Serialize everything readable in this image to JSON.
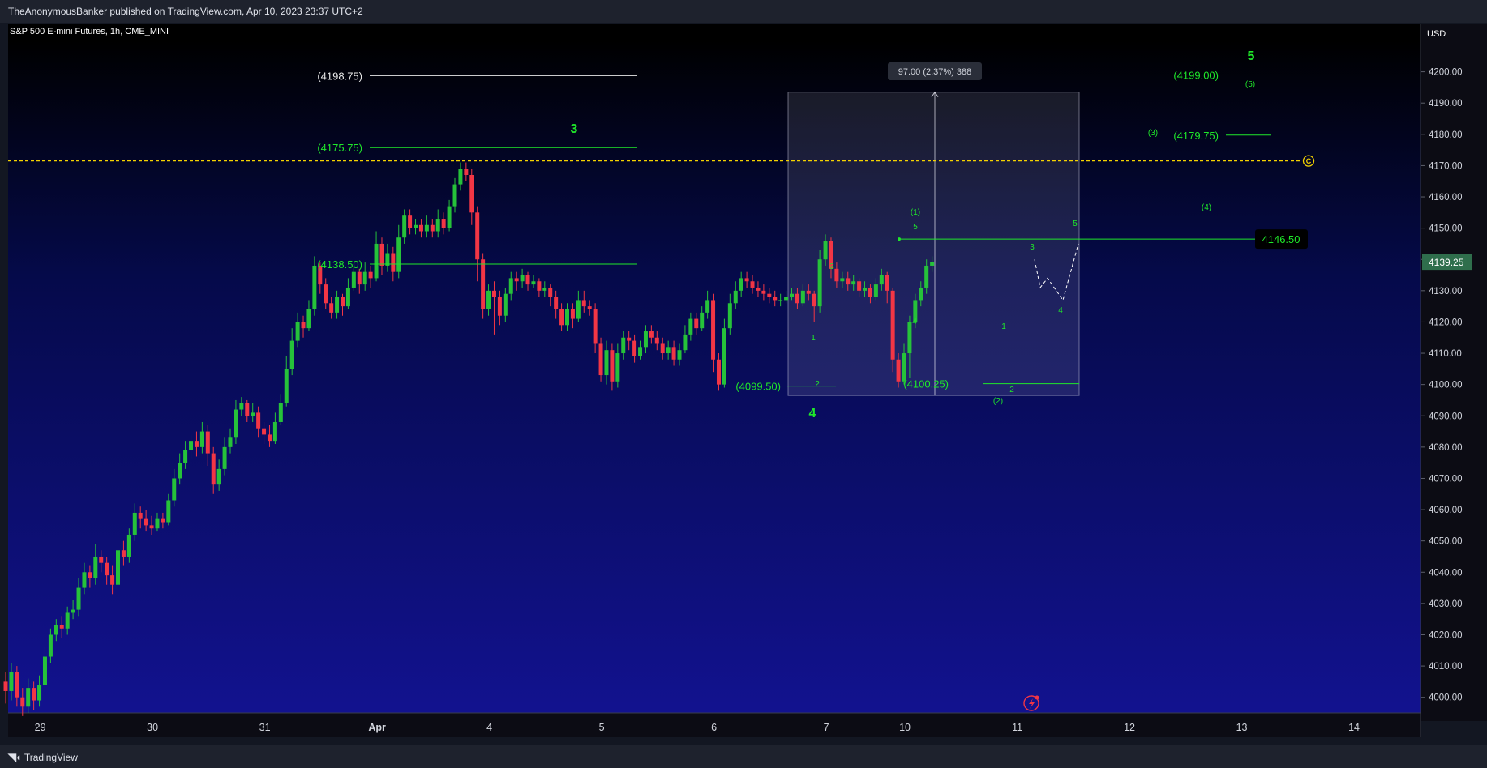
{
  "header": {
    "published_text": "TheAnonymousBanker published on TradingView.com, Apr 10, 2023 23:37 UTC+2"
  },
  "symbol": {
    "title": "S&P 500 E-mini Futures, 1h, CME_MINI",
    "currency": "USD"
  },
  "footer": {
    "brand": "TradingView"
  },
  "colors": {
    "up": "#26c23a",
    "down": "#f23645",
    "wave": "#1fe82a",
    "guide": "#f5d300",
    "axis_bg": "#0c0c14"
  },
  "chart_data": {
    "type": "candlestick",
    "ylim": [
      3995,
      4210
    ],
    "y_ticks": [
      4000,
      4010,
      4020,
      4030,
      4040,
      4050,
      4060,
      4070,
      4080,
      4090,
      4100,
      4110,
      4120,
      4130,
      4140,
      4150,
      4160,
      4170,
      4180,
      4190,
      4200
    ],
    "x_ticks": [
      {
        "label": "29",
        "i": 5
      },
      {
        "label": "30",
        "i": 25
      },
      {
        "label": "31",
        "i": 45
      },
      {
        "label": "Apr",
        "i": 65
      },
      {
        "label": "4",
        "i": 85
      },
      {
        "label": "5",
        "i": 105
      },
      {
        "label": "6",
        "i": 125
      },
      {
        "label": "7",
        "i": 145
      },
      {
        "label": "10",
        "i": 159
      },
      {
        "label": "11",
        "i": 179
      },
      {
        "label": "12",
        "i": 199
      },
      {
        "label": "13",
        "i": 219
      },
      {
        "label": "14",
        "i": 239
      }
    ],
    "last_price": {
      "value": 4139.25,
      "label": "4139.25"
    },
    "candles": [
      [
        4005,
        4002,
        4008,
        3998
      ],
      [
        4002,
        4008,
        4011,
        3999
      ],
      [
        4008,
        4000,
        4010,
        3997
      ],
      [
        4000,
        3997,
        4003,
        3994
      ],
      [
        3997,
        4003,
        4006,
        3995
      ],
      [
        4003,
        3999,
        4005,
        3996
      ],
      [
        3999,
        4004,
        4007,
        3997
      ],
      [
        4004,
        4013,
        4016,
        4002
      ],
      [
        4013,
        4020,
        4022,
        4011
      ],
      [
        4020,
        4023,
        4025,
        4018
      ],
      [
        4023,
        4022,
        4026,
        4019
      ],
      [
        4022,
        4027,
        4029,
        4020
      ],
      [
        4027,
        4028,
        4031,
        4025
      ],
      [
        4028,
        4035,
        4038,
        4026
      ],
      [
        4035,
        4040,
        4043,
        4033
      ],
      [
        4040,
        4038,
        4042,
        4035
      ],
      [
        4038,
        4045,
        4049,
        4036
      ],
      [
        4045,
        4043,
        4047,
        4040
      ],
      [
        4043,
        4039,
        4045,
        4036
      ],
      [
        4039,
        4036,
        4042,
        4033
      ],
      [
        4036,
        4047,
        4050,
        4034
      ],
      [
        4047,
        4045,
        4050,
        4042
      ],
      [
        4045,
        4052,
        4054,
        4043
      ],
      [
        4052,
        4059,
        4062,
        4050
      ],
      [
        4059,
        4057,
        4061,
        4054
      ],
      [
        4057,
        4055,
        4060,
        4053
      ],
      [
        4055,
        4054,
        4058,
        4052
      ],
      [
        4054,
        4057,
        4059,
        4053
      ],
      [
        4057,
        4056,
        4059,
        4054
      ],
      [
        4056,
        4063,
        4065,
        4055
      ],
      [
        4063,
        4070,
        4073,
        4061
      ],
      [
        4070,
        4075,
        4078,
        4068
      ],
      [
        4075,
        4079,
        4082,
        4073
      ],
      [
        4079,
        4082,
        4084,
        4076
      ],
      [
        4082,
        4080,
        4085,
        4077
      ],
      [
        4080,
        4085,
        4088,
        4078
      ],
      [
        4085,
        4078,
        4087,
        4074
      ],
      [
        4078,
        4068,
        4080,
        4065
      ],
      [
        4068,
        4073,
        4076,
        4066
      ],
      [
        4073,
        4080,
        4083,
        4071
      ],
      [
        4080,
        4083,
        4086,
        4078
      ],
      [
        4083,
        4092,
        4095,
        4081
      ],
      [
        4092,
        4094,
        4096,
        4090
      ],
      [
        4094,
        4090,
        4095,
        4088
      ],
      [
        4090,
        4091,
        4094,
        4088
      ],
      [
        4091,
        4086,
        4093,
        4083
      ],
      [
        4086,
        4084,
        4088,
        4081
      ],
      [
        4084,
        4082,
        4087,
        4080
      ],
      [
        4082,
        4088,
        4091,
        4081
      ],
      [
        4088,
        4094,
        4097,
        4087
      ],
      [
        4094,
        4105,
        4109,
        4093
      ],
      [
        4105,
        4114,
        4118,
        4103
      ],
      [
        4114,
        4120,
        4123,
        4112
      ],
      [
        4120,
        4118,
        4122,
        4115
      ],
      [
        4118,
        4124,
        4127,
        4117
      ],
      [
        4124,
        4138,
        4141,
        4122
      ],
      [
        4138,
        4132,
        4139,
        4129
      ],
      [
        4132,
        4126,
        4134,
        4124
      ],
      [
        4126,
        4123,
        4128,
        4121
      ],
      [
        4123,
        4128,
        4130,
        4121
      ],
      [
        4128,
        4125,
        4129,
        4122
      ],
      [
        4125,
        4131,
        4134,
        4124
      ],
      [
        4131,
        4136,
        4138,
        4130
      ],
      [
        4136,
        4132,
        4137,
        4129
      ],
      [
        4132,
        4136,
        4139,
        4130
      ],
      [
        4136,
        4134,
        4138,
        4131
      ],
      [
        4134,
        4145,
        4149,
        4133
      ],
      [
        4145,
        4138,
        4147,
        4135
      ],
      [
        4138,
        4142,
        4145,
        4136
      ],
      [
        4142,
        4136,
        4144,
        4133
      ],
      [
        4136,
        4147,
        4151,
        4134
      ],
      [
        4147,
        4154,
        4156,
        4145
      ],
      [
        4154,
        4150,
        4156,
        4148
      ],
      [
        4150,
        4151,
        4153,
        4148
      ],
      [
        4151,
        4149,
        4153,
        4147
      ],
      [
        4149,
        4151,
        4154,
        4147
      ],
      [
        4151,
        4149,
        4153,
        4147
      ],
      [
        4149,
        4153,
        4156,
        4147
      ],
      [
        4153,
        4150,
        4155,
        4148
      ],
      [
        4150,
        4157,
        4159,
        4149
      ],
      [
        4157,
        4164,
        4166,
        4155
      ],
      [
        4164,
        4169,
        4171,
        4162
      ],
      [
        4169,
        4167,
        4171,
        4165
      ],
      [
        4167,
        4155,
        4169,
        4151
      ],
      [
        4155,
        4140,
        4157,
        4133
      ],
      [
        4140,
        4124,
        4142,
        4121
      ],
      [
        4124,
        4130,
        4132,
        4122
      ],
      [
        4130,
        4128,
        4133,
        4116
      ],
      [
        4128,
        4122,
        4130,
        4119
      ],
      [
        4122,
        4129,
        4131,
        4120
      ],
      [
        4129,
        4134,
        4136,
        4127
      ],
      [
        4134,
        4133,
        4136,
        4130
      ],
      [
        4133,
        4135,
        4137,
        4131
      ],
      [
        4135,
        4132,
        4136,
        4130
      ],
      [
        4132,
        4133,
        4135,
        4131
      ],
      [
        4133,
        4130,
        4134,
        4128
      ],
      [
        4130,
        4131,
        4133,
        4128
      ],
      [
        4131,
        4128,
        4132,
        4125
      ],
      [
        4128,
        4124,
        4130,
        4121
      ],
      [
        4124,
        4119,
        4126,
        4117
      ],
      [
        4119,
        4124,
        4126,
        4117
      ],
      [
        4124,
        4121,
        4126,
        4118
      ],
      [
        4121,
        4127,
        4130,
        4120
      ],
      [
        4127,
        4125,
        4130,
        4123
      ],
      [
        4125,
        4124,
        4127,
        4122
      ],
      [
        4124,
        4113,
        4126,
        4110
      ],
      [
        4113,
        4103,
        4115,
        4101
      ],
      [
        4103,
        4111,
        4114,
        4100
      ],
      [
        4111,
        4101,
        4113,
        4098
      ],
      [
        4101,
        4110,
        4113,
        4099
      ],
      [
        4110,
        4115,
        4117,
        4108
      ],
      [
        4115,
        4114,
        4117,
        4111
      ],
      [
        4114,
        4109,
        4116,
        4107
      ],
      [
        4109,
        4112,
        4114,
        4108
      ],
      [
        4112,
        4117,
        4119,
        4110
      ],
      [
        4117,
        4115,
        4119,
        4113
      ],
      [
        4115,
        4113,
        4117,
        4111
      ],
      [
        4113,
        4110,
        4115,
        4108
      ],
      [
        4110,
        4112,
        4114,
        4108
      ],
      [
        4112,
        4108,
        4114,
        4106
      ],
      [
        4108,
        4111,
        4113,
        4106
      ],
      [
        4111,
        4116,
        4119,
        4110
      ],
      [
        4116,
        4121,
        4123,
        4114
      ],
      [
        4121,
        4118,
        4123,
        4116
      ],
      [
        4118,
        4123,
        4125,
        4117
      ],
      [
        4123,
        4127,
        4130,
        4121
      ],
      [
        4127,
        4108,
        4129,
        4104
      ],
      [
        4108,
        4100,
        4110,
        4098
      ],
      [
        4100,
        4118,
        4121,
        4099
      ],
      [
        4118,
        4126,
        4129,
        4116
      ],
      [
        4126,
        4130,
        4133,
        4124
      ],
      [
        4130,
        4134,
        4136,
        4128
      ],
      [
        4134,
        4133,
        4136,
        4131
      ],
      [
        4133,
        4131,
        4135,
        4129
      ],
      [
        4131,
        4130,
        4133,
        4128
      ],
      [
        4130,
        4129,
        4132,
        4127
      ],
      [
        4129,
        4128,
        4131,
        4126
      ],
      [
        4128,
        4127,
        4130,
        4125
      ],
      [
        4127,
        4127,
        4129,
        4125
      ],
      [
        4127,
        4128,
        4130,
        4126
      ],
      [
        4128,
        4129,
        4131,
        4127
      ],
      [
        4129,
        4126,
        4131,
        4124
      ],
      [
        4126,
        4130,
        4132,
        4125
      ],
      [
        4130,
        4129,
        4132,
        4127
      ],
      [
        4129,
        4125,
        4130,
        4120
      ],
      [
        4125,
        4140,
        4143,
        4123
      ],
      [
        4140,
        4146,
        4148,
        4138
      ],
      [
        4146,
        4137,
        4147,
        4134
      ],
      [
        4137,
        4133,
        4139,
        4131
      ],
      [
        4133,
        4134,
        4136,
        4131
      ],
      [
        4134,
        4132,
        4136,
        4130
      ],
      [
        4132,
        4133,
        4135,
        4130
      ],
      [
        4133,
        4130,
        4134,
        4128
      ],
      [
        4130,
        4131,
        4133,
        4128
      ],
      [
        4131,
        4128,
        4132,
        4126
      ],
      [
        4128,
        4132,
        4134,
        4127
      ],
      [
        4132,
        4135,
        4137,
        4130
      ],
      [
        4135,
        4130,
        4136,
        4126
      ],
      [
        4130,
        4108,
        4131,
        4104
      ],
      [
        4108,
        4101,
        4110,
        4099
      ],
      [
        4101,
        4110,
        4113,
        4100
      ],
      [
        4110,
        4120,
        4122,
        4102
      ],
      [
        4120,
        4127,
        4129,
        4118
      ],
      [
        4127,
        4131,
        4133,
        4125
      ],
      [
        4131,
        4138,
        4140,
        4129
      ],
      [
        4138,
        4139.25,
        4141,
        4136
      ]
    ],
    "annotations": {
      "levels": [
        {
          "label": "(4198.75)",
          "value": 4198.75,
          "style": "white"
        },
        {
          "label": "(4175.75)",
          "value": 4175.75,
          "style": "green"
        },
        {
          "label": "(4138.50)",
          "value": 4138.5,
          "style": "green"
        },
        {
          "label": "(4099.50)",
          "value": 4099.5,
          "style": "green"
        },
        {
          "label": "(4100.25)",
          "value": 4100.25,
          "style": "green"
        },
        {
          "label": "(4199.00)",
          "value": 4199.0,
          "style": "green"
        },
        {
          "label": "(4179.75)",
          "value": 4179.75,
          "style": "green"
        },
        {
          "label": "4146.50",
          "value": 4146.5,
          "style": "box"
        }
      ],
      "guide_line": {
        "value": 4171.5,
        "marker": "C"
      },
      "measure": {
        "label": "97.00 (2.37%) 388",
        "from": 4096.5,
        "to": 4193.5
      },
      "waves": [
        "3",
        "4",
        "5",
        "(1)",
        "(2)",
        "(3)",
        "(4)",
        "(5)",
        "1",
        "2",
        "3",
        "4",
        "5"
      ]
    }
  }
}
